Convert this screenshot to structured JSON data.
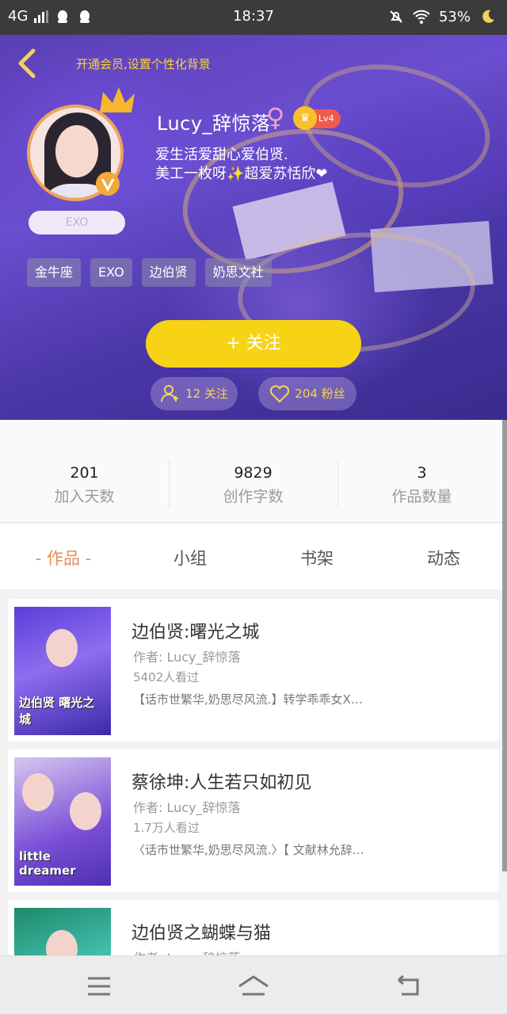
{
  "status_bar": {
    "network": "4G",
    "time": "18:37",
    "battery": "53%"
  },
  "header": {
    "vip_tip": "开通会员,设置个性化背景",
    "username": "Lucy_辞惊落",
    "gender_symbol": "♀",
    "level": "Lv4",
    "bio_line1": "爱生活爱甜心爱伯贤.",
    "bio_line2": "美工一枚呀✨超爱苏恬欣❤",
    "fan_badge": "EXO",
    "tags": [
      "金牛座",
      "EXO",
      "边伯贤",
      "奶思文社"
    ],
    "follow_button": "+ 关注",
    "following": "12 关注",
    "followers": "204 粉丝"
  },
  "stats": [
    {
      "value": "201",
      "label": "加入天数"
    },
    {
      "value": "9829",
      "label": "创作字数"
    },
    {
      "value": "3",
      "label": "作品数量"
    }
  ],
  "tabs": [
    "- 作品 -",
    "小组",
    "书架",
    "动态"
  ],
  "works": [
    {
      "title": "边伯贤:曙光之城",
      "author": "作者: Lucy_辞惊落",
      "views": "5402人看过",
      "desc": "【话市世繁华,奶思尽风流.】转学乖乖女X…",
      "cover_text": "边伯贤 曙光之城"
    },
    {
      "title": "蔡徐坤:人生若只如初见",
      "author": "作者: Lucy_辞惊落",
      "views": "1.7万人看过",
      "desc": "〈话市世繁华,奶思尽风流.〉【 文献林允辞…",
      "cover_text": "little dreamer"
    },
    {
      "title": "边伯贤之蝴蝶与猫",
      "author": "作者: Lucy_辞惊落",
      "views": "",
      "desc": "",
      "cover_text": ""
    }
  ],
  "colors": {
    "accent_yellow": "#f7d316",
    "active_tab": "#f08a4e",
    "hero_purple": "#5b3fb5"
  }
}
